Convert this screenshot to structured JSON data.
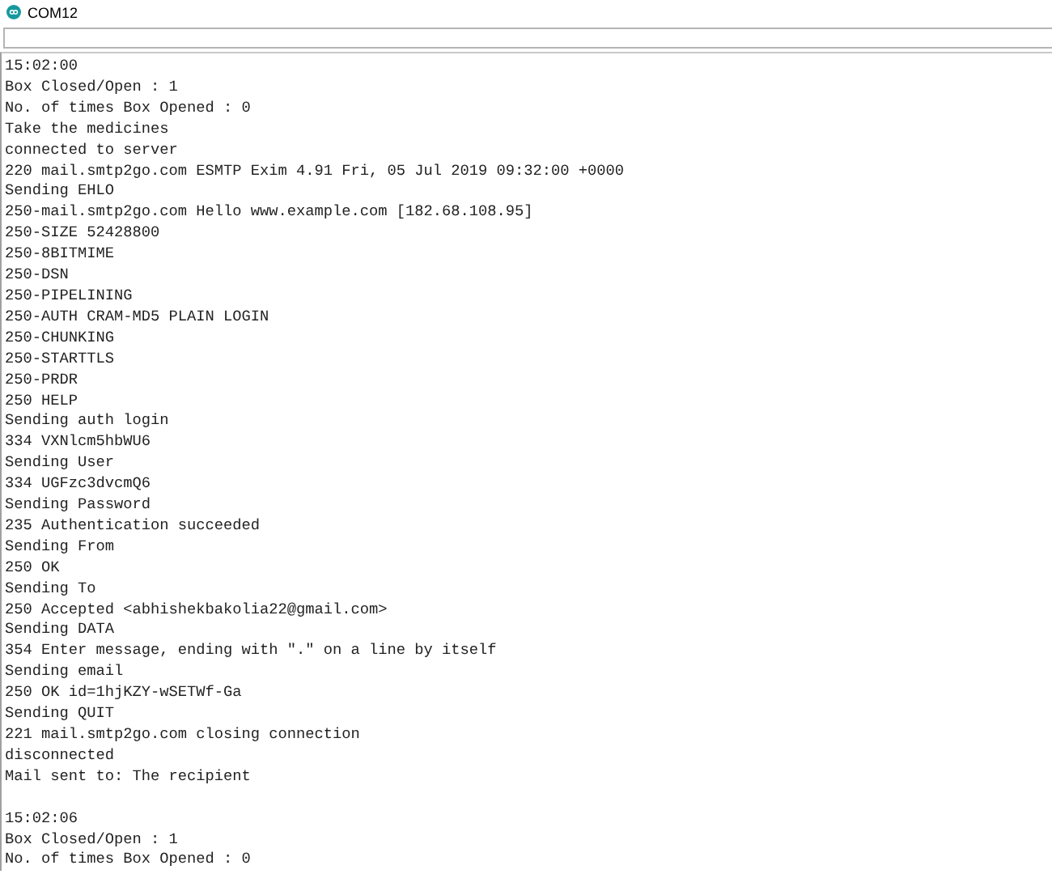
{
  "window": {
    "title": "COM12"
  },
  "log": [
    {
      "lines": [
        "15:02:00",
        "Box Closed/Open : 1",
        "No. of times Box Opened : 0",
        "Take the medicines",
        "connected to server",
        "220 mail.smtp2go.com ESMTP Exim 4.91 Fri, 05 Jul 2019 09:32:00 +0000",
        "Sending EHLO",
        "250-mail.smtp2go.com Hello www.example.com [182.68.108.95]",
        "250-SIZE 52428800",
        "250-8BITMIME",
        "250-DSN",
        "250-PIPELINING",
        "250-AUTH CRAM-MD5 PLAIN LOGIN",
        "250-CHUNKING",
        "250-STARTTLS",
        "250-PRDR",
        "250 HELP",
        "Sending auth login",
        "334 VXNlcm5hbWU6",
        "Sending User",
        "334 UGFzc3dvcmQ6",
        "Sending Password",
        "235 Authentication succeeded",
        "Sending From",
        "250 OK",
        "Sending To",
        "250 Accepted <abhishekbakolia22@gmail.com>",
        "Sending DATA",
        "354 Enter message, ending with \".\" on a line by itself",
        "Sending email",
        "250 OK id=1hjKZY-wSETWf-Ga",
        "Sending QUIT",
        "221 mail.smtp2go.com closing connection",
        "disconnected",
        "Mail sent to: The recipient"
      ]
    },
    {
      "lines": [
        "15:02:06",
        "Box Closed/Open : 1",
        "No. of times Box Opened : 0"
      ]
    }
  ]
}
